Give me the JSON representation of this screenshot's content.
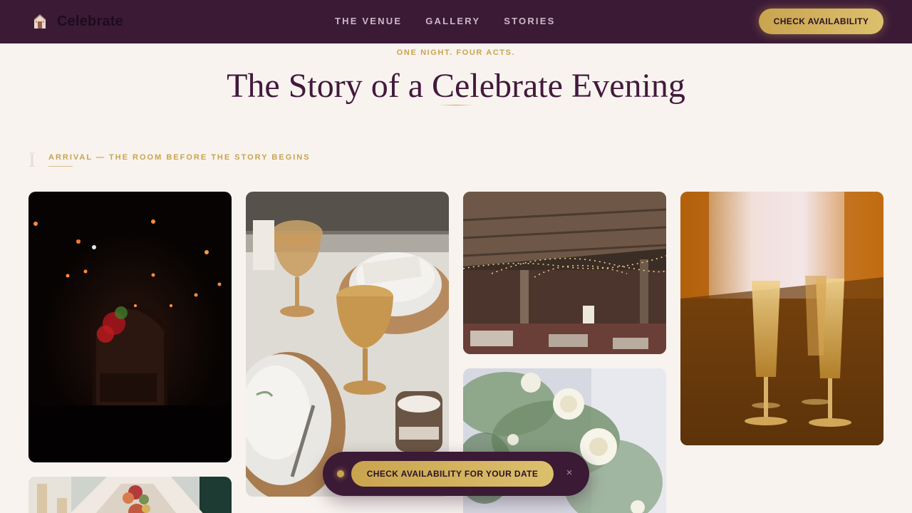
{
  "nav": {
    "brand": "Celebrate",
    "links": [
      "THE VENUE",
      "GALLERY",
      "STORIES"
    ],
    "cta": "CHECK AVAILABILITY"
  },
  "hero": {
    "kicker": "ONE NIGHT. FOUR ACTS.",
    "title": "The Story of a Celebrate Evening"
  },
  "section": {
    "numeral": "I",
    "label": "ARRIVAL — THE ROOM BEFORE THE STORY BEGINS"
  },
  "floating_bar": {
    "cta": "CHECK AVAILABILITY FOR YOUR DATE",
    "close": "×"
  },
  "colors": {
    "nav_bg": "#3b1a36",
    "gold": "#c9a44e",
    "plum_text": "#43193c",
    "page_bg": "#f8f3ef"
  },
  "icons": {
    "brand": "venue-house-icon",
    "close": "close-icon"
  }
}
